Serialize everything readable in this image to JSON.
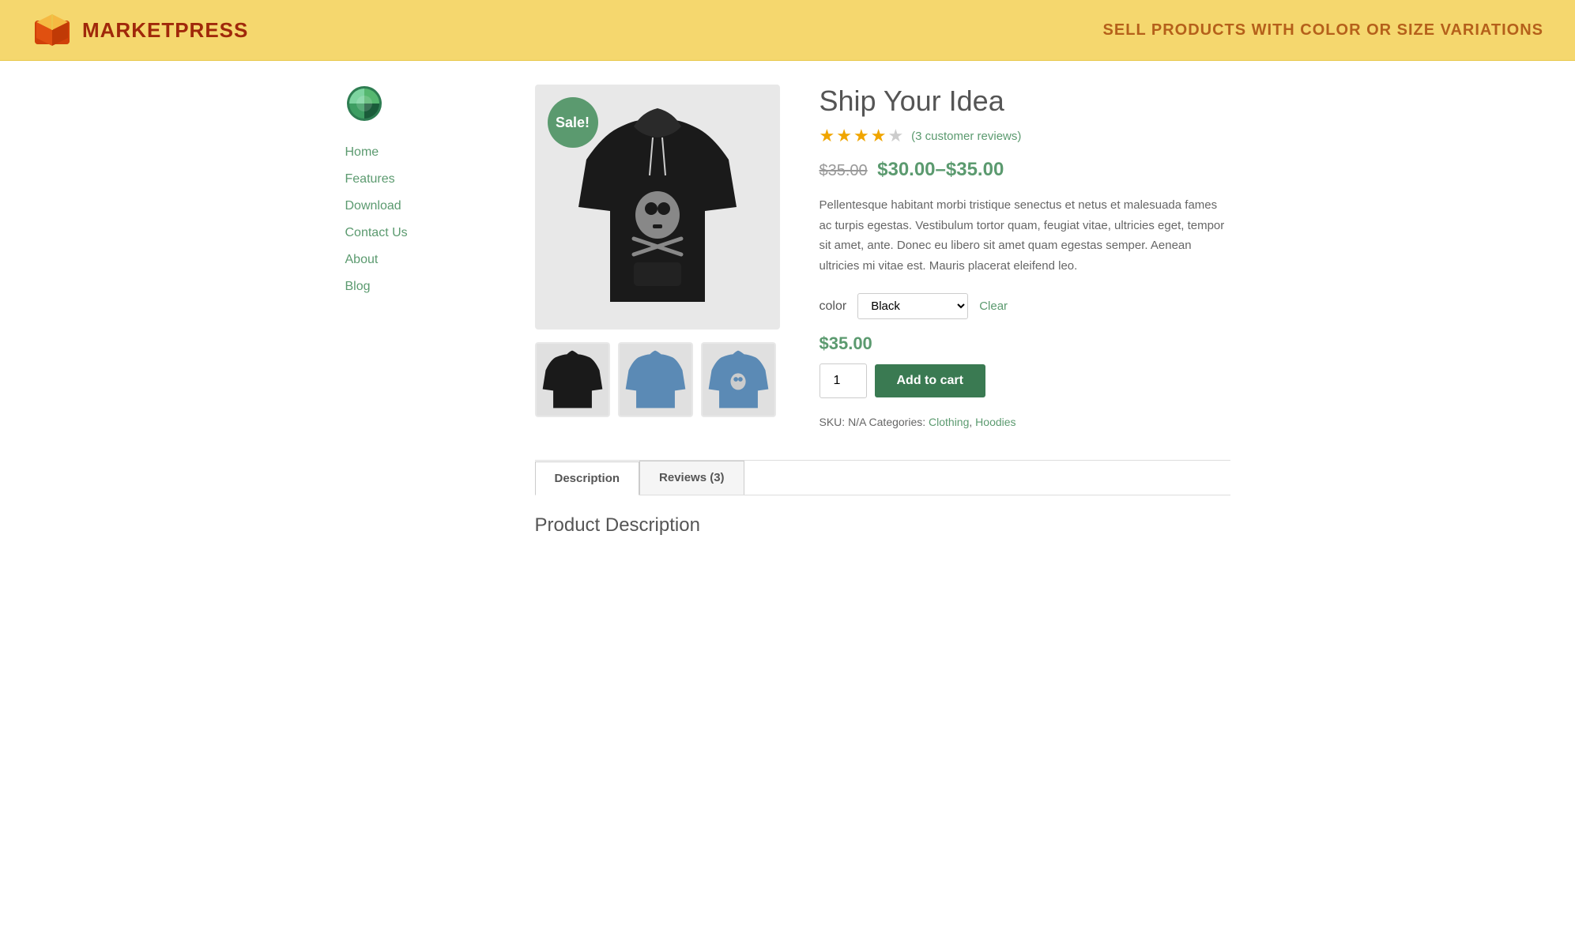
{
  "header": {
    "logo_text": "MARKETPRESS",
    "tagline": "SELL PRODUCTS WITH COLOR OR SIZE VARIATIONS"
  },
  "sidebar": {
    "nav_items": [
      {
        "label": "Home",
        "id": "home"
      },
      {
        "label": "Features",
        "id": "features"
      },
      {
        "label": "Download",
        "id": "download"
      },
      {
        "label": "Contact Us",
        "id": "contact"
      },
      {
        "label": "About",
        "id": "about"
      },
      {
        "label": "Blog",
        "id": "blog"
      }
    ]
  },
  "product": {
    "title": "Ship Your Idea",
    "sale_badge": "Sale!",
    "rating": 3.5,
    "review_count": "3 customer reviews",
    "price_old": "$35.00",
    "price_range": "$30.00–$35.00",
    "description": "Pellentesque habitant morbi tristique senectus et netus et malesuada fames ac turpis egestas. Vestibulum tortor quam, feugiat vitae, ultricies eget, tempor sit amet, ante. Donec eu libero sit amet quam egestas semper. Aenean ultricies mi vitae est. Mauris placerat eleifend leo.",
    "color_label": "color",
    "color_selected": "Black",
    "color_options": [
      "Black",
      "Blue"
    ],
    "clear_label": "Clear",
    "cart_price": "$35.00",
    "qty_value": "1",
    "add_to_cart_label": "Add to cart",
    "sku": "N/A",
    "categories": [
      "Clothing",
      "Hoodies"
    ]
  },
  "tabs": [
    {
      "label": "Description",
      "id": "description",
      "active": true
    },
    {
      "label": "Reviews (3)",
      "id": "reviews",
      "active": false
    }
  ],
  "tab_content": {
    "heading": "Product Description"
  }
}
